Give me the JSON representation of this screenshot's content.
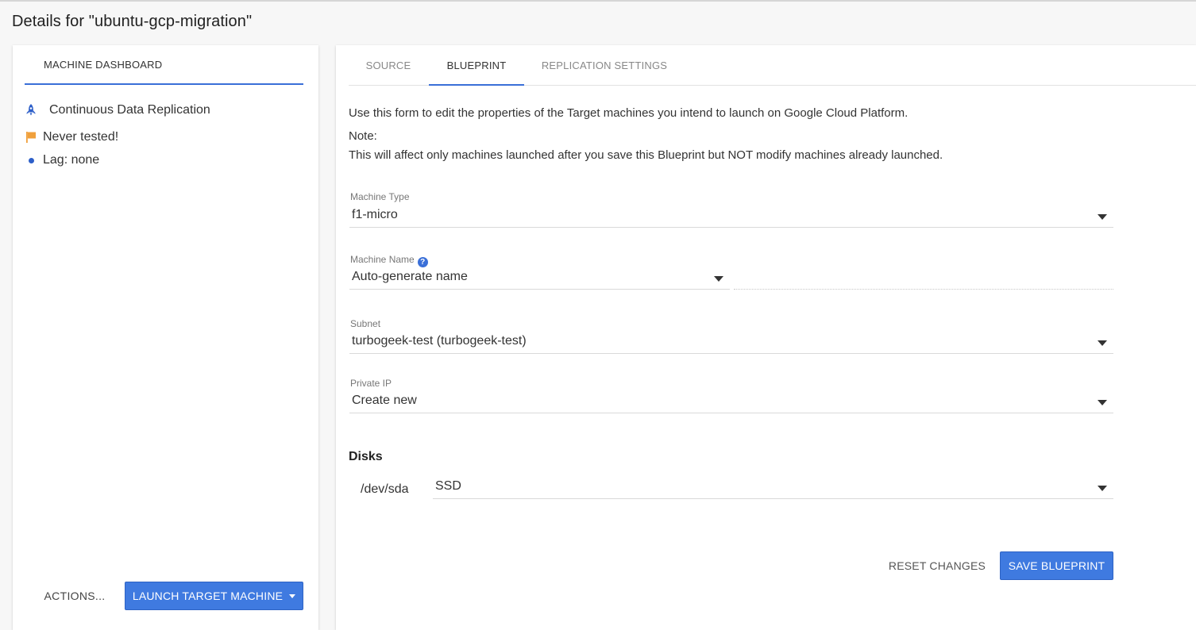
{
  "page": {
    "title": "Details for \"ubuntu-gcp-migration\""
  },
  "left_panel": {
    "tab_label": "MACHINE DASHBOARD",
    "status": {
      "replication": {
        "icon": "rocket-icon",
        "label": "Continuous Data Replication"
      },
      "test": {
        "icon": "flag-icon",
        "label": "Never tested!"
      },
      "lag": {
        "icon": "dot-icon",
        "label": "Lag: none"
      }
    },
    "actions_label": "ACTIONS...",
    "launch_label": "LAUNCH TARGET MACHINE"
  },
  "tabs": {
    "source": "SOURCE",
    "blueprint": "BLUEPRINT",
    "replication_settings": "REPLICATION SETTINGS",
    "active": "BLUEPRINT"
  },
  "blueprint": {
    "intro": "Use this form to edit the properties of the Target machines you intend to launch on Google Cloud Platform.",
    "note_title": "Note:",
    "note_text": "This will affect only machines launched after you save this Blueprint but NOT modify machines already launched.",
    "machine_type": {
      "label": "Machine Type",
      "value": "f1-micro"
    },
    "machine_name": {
      "label": "Machine Name",
      "value": "Auto-generate name",
      "help_icon": "question-mark-icon"
    },
    "subnet": {
      "label": "Subnet",
      "value": "turbogeek-test (turbogeek-test)"
    },
    "private_ip": {
      "label": "Private IP",
      "value": "Create new"
    },
    "disks": {
      "title": "Disks",
      "items": [
        {
          "device": "/dev/sda",
          "type": "SSD"
        }
      ]
    },
    "reset_label": "RESET CHANGES",
    "save_label": "SAVE BLUEPRINT"
  },
  "colors": {
    "accent": "#3f7ae0",
    "tab_indicator": "#3a6fd8",
    "flag": "#f0a03c",
    "background": "#f7f7f7"
  }
}
